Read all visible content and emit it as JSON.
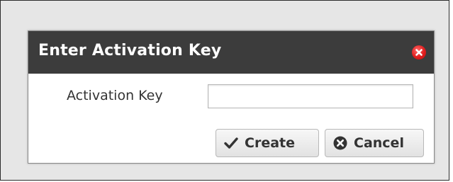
{
  "dialog": {
    "title": "Enter Activation Key",
    "close_icon": "close-circle-icon",
    "close_color": "#e01e1e"
  },
  "form": {
    "activation_key_label": "Activation Key",
    "activation_key_value": "",
    "activation_key_placeholder": ""
  },
  "buttons": {
    "create_label": "Create",
    "create_icon": "checkmark-icon",
    "cancel_label": "Cancel",
    "cancel_icon": "close-circle-icon"
  },
  "colors": {
    "titlebar": "#3c3c3c",
    "title_text": "#ffffff",
    "background": "#e6e6e6"
  }
}
